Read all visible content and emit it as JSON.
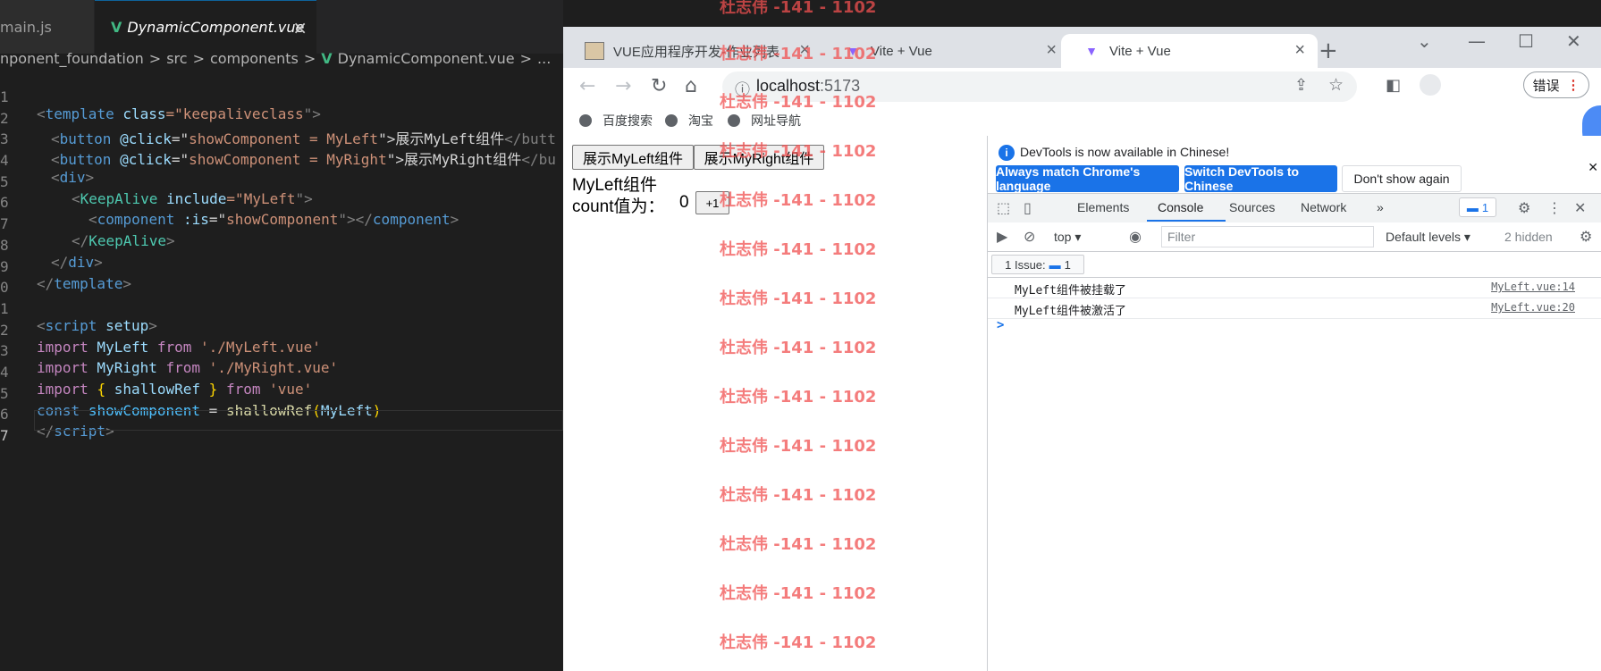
{
  "vscode": {
    "tabs": [
      {
        "label": "main.js"
      },
      {
        "label": "DynamicComponent.vue",
        "close": "×"
      }
    ],
    "breadcrumb": [
      "nponent_foundation",
      ">",
      "src",
      ">",
      "components",
      ">",
      "DynamicComponent.vue",
      ">",
      "..."
    ],
    "lines": [
      {
        "n": "1"
      },
      {
        "n": "2"
      },
      {
        "n": "3"
      },
      {
        "n": "4"
      },
      {
        "n": "5"
      },
      {
        "n": "6"
      },
      {
        "n": "7"
      },
      {
        "n": "8"
      },
      {
        "n": "9"
      },
      {
        "n": "0"
      },
      {
        "n": "1"
      },
      {
        "n": "2"
      },
      {
        "n": "3"
      },
      {
        "n": "4"
      },
      {
        "n": "5"
      },
      {
        "n": "6"
      },
      {
        "n": "7"
      }
    ],
    "code": {
      "l1": [
        "<",
        "template",
        " ",
        "class",
        "=\"",
        "keepaliveclass",
        "\">"
      ],
      "l2": [
        "<",
        "button",
        " ",
        "@click",
        "=\"",
        "showComponent = MyLeft",
        "\">",
        "展示MyLeft组件",
        "</butt"
      ],
      "l3": [
        "<",
        "button",
        " ",
        "@click",
        "=\"",
        "showComponent = MyRight",
        "\">",
        "展示MyRight组件",
        "</bu"
      ],
      "l4": [
        "<",
        "div",
        ">"
      ],
      "l5": [
        "<",
        "KeepAlive",
        " ",
        "include",
        "=\"",
        "MyLeft",
        "\">"
      ],
      "l6": [
        "<",
        "component",
        " ",
        ":is",
        "=\"",
        "showComponent",
        "\"></",
        "component",
        ">"
      ],
      "l7": [
        "</",
        "KeepAlive",
        ">"
      ],
      "l8": [
        "</",
        "div",
        ">"
      ],
      "l9": [
        "</",
        "template",
        ">"
      ],
      "l11": [
        "<",
        "script",
        " ",
        "setup",
        ">"
      ],
      "l12": [
        "import",
        " MyLeft ",
        "from",
        " ",
        "'./MyLeft.vue'"
      ],
      "l13": [
        "import",
        " MyRight ",
        "from",
        " ",
        "'./MyRight.vue'"
      ],
      "l14": [
        "import",
        " ",
        "{",
        " shallowRef ",
        "}",
        " ",
        "from",
        " ",
        "'vue'"
      ],
      "l15": [
        "const",
        " ",
        "showComponent",
        " = ",
        "shallowRef",
        "(",
        "MyLeft",
        ")"
      ],
      "l16": [
        "</",
        "script",
        ">"
      ]
    }
  },
  "chrome": {
    "tabs": [
      {
        "label": "VUE应用程序开发-作业列表",
        "close": "×"
      },
      {
        "label": "Vite + Vue",
        "close": "×"
      },
      {
        "label": "Vite + Vue",
        "close": "×"
      }
    ],
    "new_tab": "+",
    "url_host": "localhost",
    "url_port": ":5173",
    "error_button": "错误",
    "bookmarks": [
      "百度搜索",
      "淘宝",
      "网址导航"
    ]
  },
  "page": {
    "btn_left": "展示MyLeft组件",
    "btn_right": "展示MyRight组件",
    "title": "MyLeft组件",
    "count_label": "count值为：",
    "count_value": "0",
    "plus_button": "+1"
  },
  "devtools": {
    "info_text": "DevTools is now available in Chinese!",
    "btn_match": "Always match Chrome's language",
    "btn_switch": "Switch DevTools to Chinese",
    "btn_dont": "Don't show again",
    "tabs": [
      "Elements",
      "Console",
      "Sources",
      "Network"
    ],
    "more": "»",
    "message_badge": "1",
    "context": "top",
    "filter_placeholder": "Filter",
    "levels": "Default levels",
    "hidden": "2 hidden",
    "issues": "1 Issue:",
    "issues_count": "1",
    "logs": [
      {
        "msg": "MyLeft组件被挂载了",
        "src": "MyLeft.vue:14"
      },
      {
        "msg": "MyLeft组件被激活了",
        "src": "MyLeft.vue:20"
      }
    ],
    "prompt": ">"
  },
  "watermark": {
    "text": "杜志伟 -141 - 1102"
  }
}
